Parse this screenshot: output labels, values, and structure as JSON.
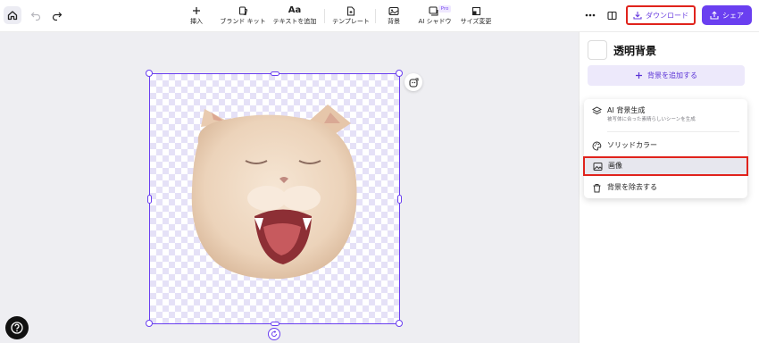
{
  "toolbar": {
    "tools": [
      {
        "icon": "plus-icon",
        "label": "挿入"
      },
      {
        "icon": "brand-kit-icon",
        "label": "ブランド キット"
      },
      {
        "icon": "text-icon",
        "glyph": "Aa",
        "label": "テキストを追加"
      },
      {
        "icon": "template-icon",
        "label": "テンプレート"
      },
      {
        "icon": "background-icon",
        "label": "背景"
      },
      {
        "icon": "ai-shadow-icon",
        "label": "AI シャドウ"
      },
      {
        "icon": "resize-icon",
        "label": "サイズ変更"
      }
    ],
    "pro_badge": "Pro",
    "download_label": "ダウンロード",
    "share_label": "シェア"
  },
  "panel": {
    "title": "透明背景",
    "add_background_label": "背景を追加する"
  },
  "menu": {
    "items": [
      {
        "label": "AI 背景生成",
        "sublabel": "被写体に合った素晴らしいシーンを生成",
        "icon": "ai-layers-icon"
      },
      {
        "label": "ソリッドカラー",
        "icon": "palette-icon"
      },
      {
        "label": "画像",
        "icon": "image-icon",
        "selected": true
      },
      {
        "label": "背景を除去する",
        "icon": "trash-icon"
      }
    ]
  },
  "colors": {
    "accent": "#6a3ff0",
    "highlight": "#e0231c",
    "canvas_bg": "#eeeef2"
  }
}
